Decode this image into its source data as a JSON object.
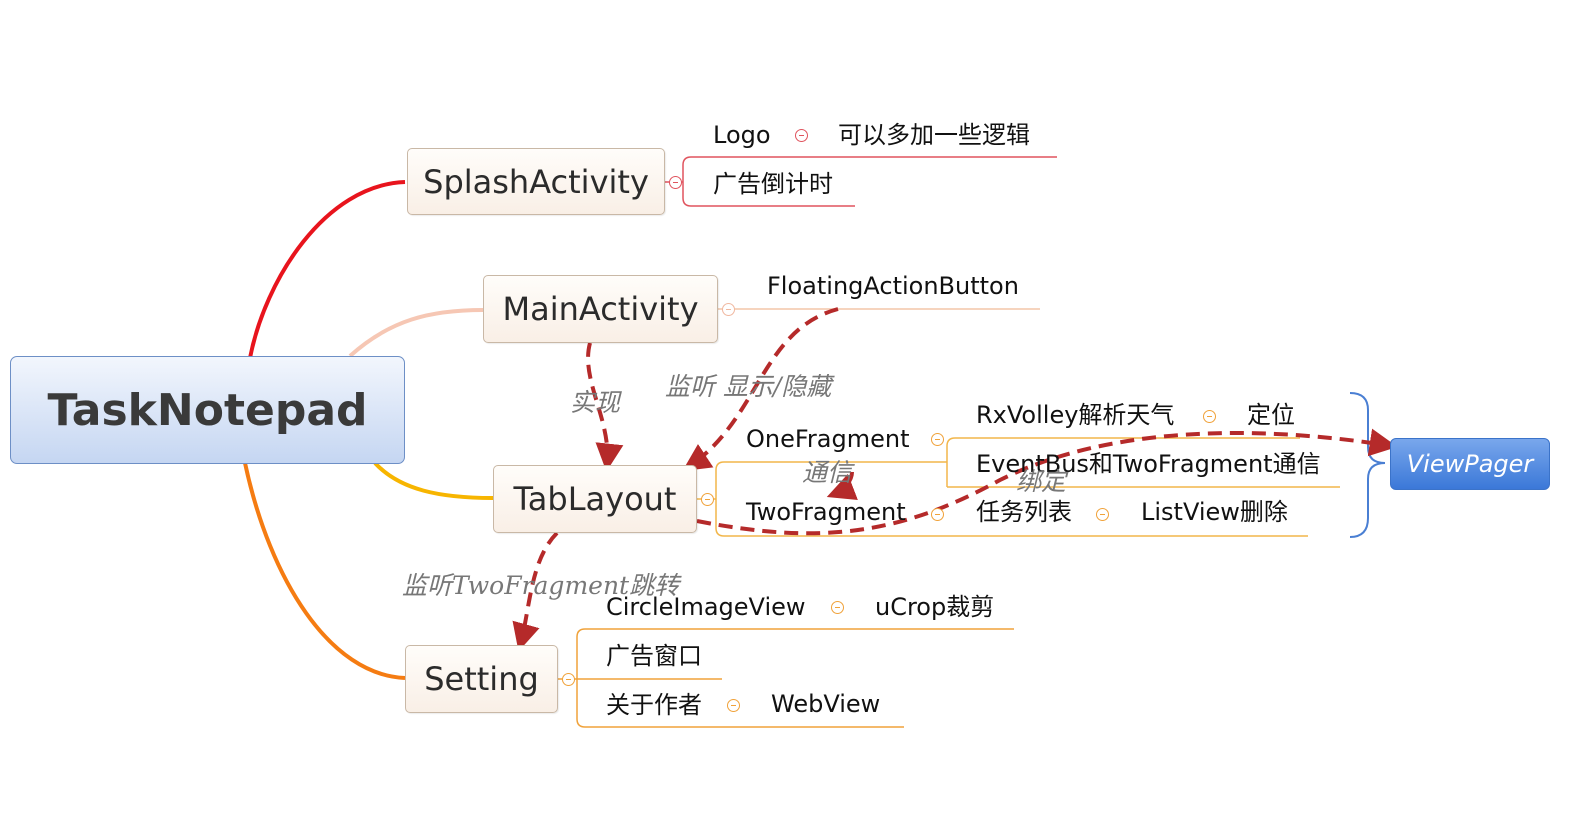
{
  "root": {
    "label": "TaskNotepad"
  },
  "branches": {
    "splash": {
      "label": "SplashActivity",
      "children": {
        "logo": "Logo",
        "logo_note": "可以多加一些逻辑",
        "ad_countdown": "广告倒计时"
      }
    },
    "main": {
      "label": "MainActivity",
      "children": {
        "fab": "FloatingActionButton"
      }
    },
    "tablayout": {
      "label": "TabLayout",
      "children": {
        "one_fragment": "OneFragment",
        "rxvolley": "RxVolley解析天气",
        "locate": "定位",
        "eventbus": "EventBus和TwoFragment通信",
        "two_fragment": "TwoFragment",
        "task_list": "任务列表",
        "listview_delete": "ListView删除"
      }
    },
    "setting": {
      "label": "Setting",
      "children": {
        "circle_image": "CircleImageView",
        "ucrop": "uCrop裁剪",
        "ad_window": "广告窗口",
        "about": "关于作者",
        "webview": "WebView"
      }
    }
  },
  "summary": {
    "viewpager": "ViewPager"
  },
  "relationships": {
    "implement": "实现",
    "listen_show_hide": "监听 显示/隐藏",
    "communicate": "通信",
    "bind": "绑定",
    "listen_jump": "监听TwoFragment跳转"
  },
  "colors": {
    "splash_branch": "#e8141d",
    "main_branch": "#f6c7b4",
    "tab_branch": "#f7b500",
    "setting_branch": "#f57c12",
    "relationship_arrow": "#b52a2a",
    "summary_fill": "#3b78d8"
  }
}
